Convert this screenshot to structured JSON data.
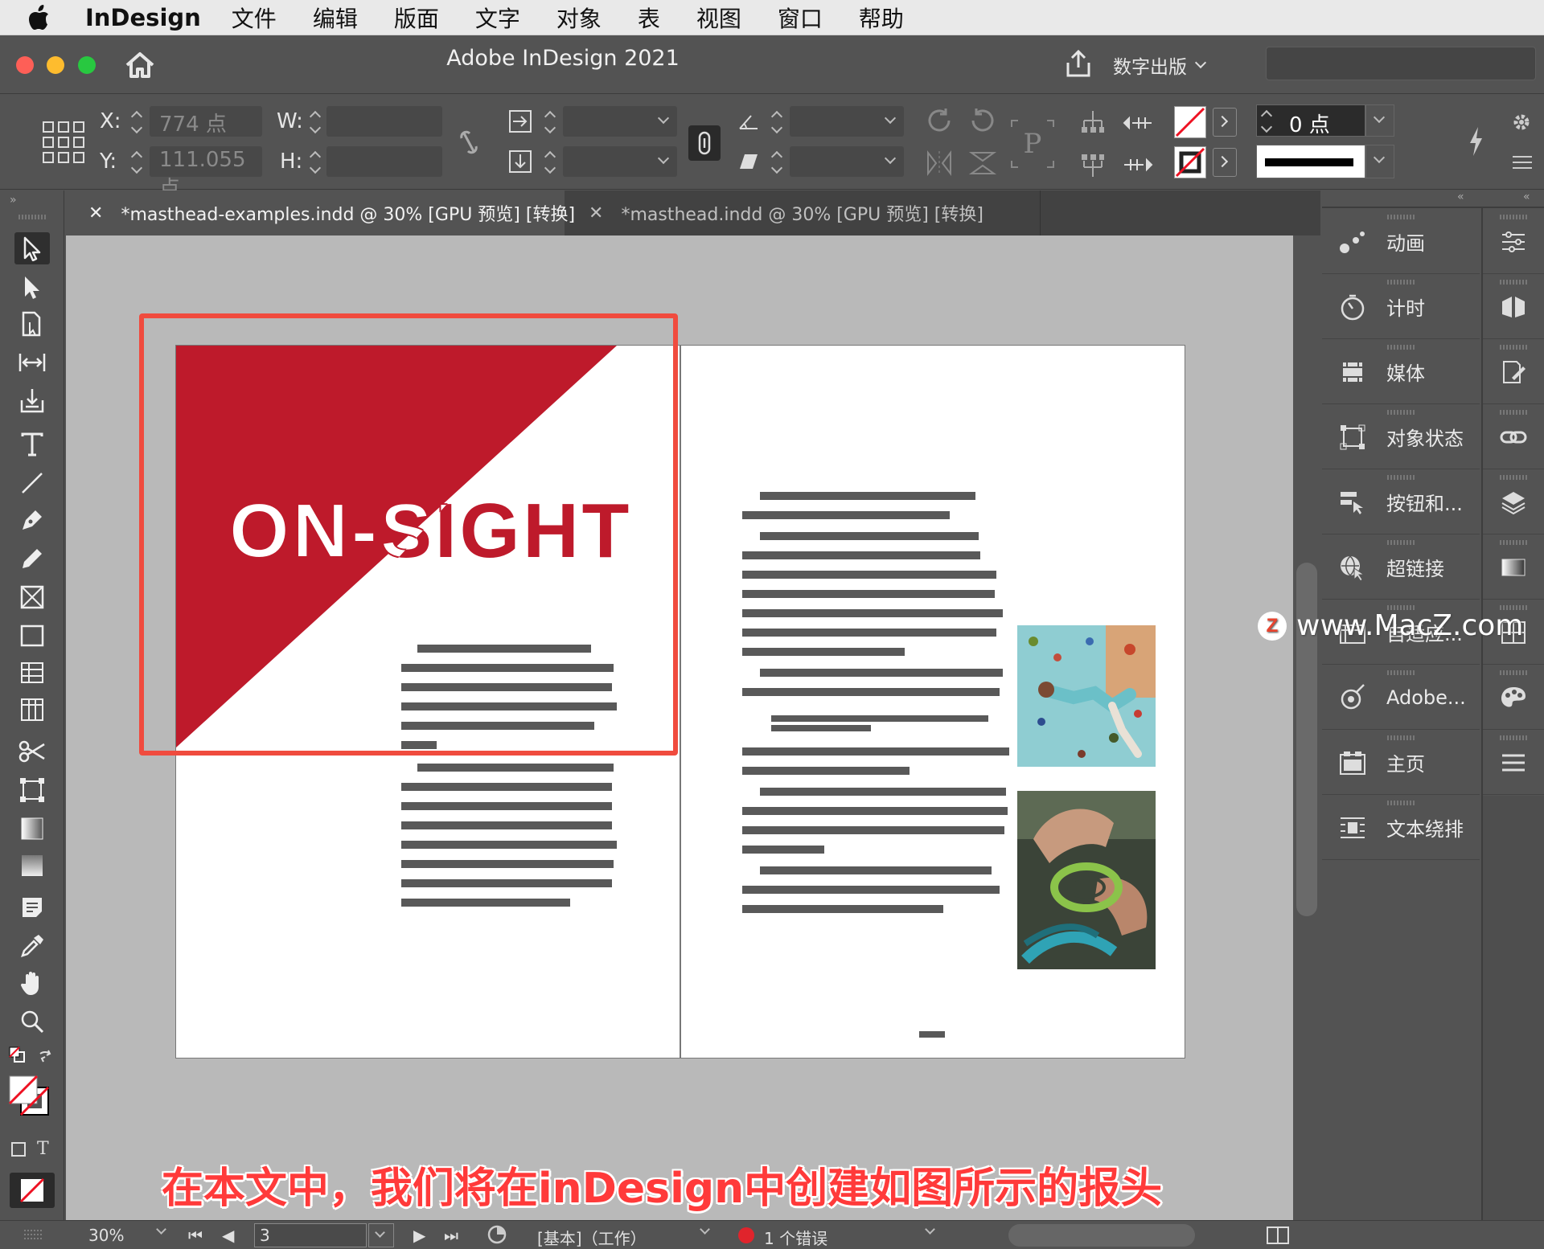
{
  "menubar": {
    "app_name": "InDesign",
    "items": [
      "文件",
      "编辑",
      "版面",
      "文字",
      "对象",
      "表",
      "视图",
      "窗口",
      "帮助"
    ]
  },
  "titlebar": {
    "title": "Adobe InDesign 2021",
    "workspace": "数字出版"
  },
  "controlbar": {
    "x_label": "X:",
    "x_value": "774 点",
    "y_label": "Y:",
    "y_value": "111.055 点",
    "w_label": "W:",
    "h_label": "H:",
    "stroke_weight": "0 点"
  },
  "tabs": [
    {
      "label": "*masthead-examples.indd @ 30% [GPU 预览] [转换]",
      "active": true
    },
    {
      "label": "*masthead.indd @ 30% [GPU 预览] [转换]",
      "active": false
    }
  ],
  "document": {
    "masthead_text": "ON-SIGHT",
    "brand_color": "#be1a2b"
  },
  "panels": [
    {
      "label": "动画",
      "icon": "animation-icon"
    },
    {
      "label": "计时",
      "icon": "timer-icon"
    },
    {
      "label": "媒体",
      "icon": "media-icon"
    },
    {
      "label": "对象状态",
      "icon": "object-states-icon"
    },
    {
      "label": "按钮和...",
      "icon": "buttons-icon"
    },
    {
      "label": "超链接",
      "icon": "hyperlink-icon"
    },
    {
      "label": "自适应...",
      "icon": "liquid-layout-icon"
    },
    {
      "label": "Adobe...",
      "icon": "adobe-color-icon"
    },
    {
      "label": "主页",
      "icon": "pages-icon"
    },
    {
      "label": "文本绕排",
      "icon": "text-wrap-icon"
    }
  ],
  "statusbar": {
    "zoom": "30%",
    "page": "3",
    "preflight_profile": "[基本]（工作）",
    "errors": "1 个错误"
  },
  "caption": "在本文中，我们将在inDesign中创建如图所示的报头",
  "watermark": "www.MacZ.com"
}
